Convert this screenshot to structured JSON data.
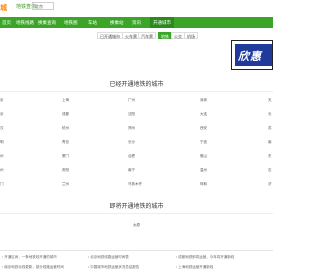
{
  "header": {
    "logo_text": "城",
    "site_name": "地铁查询",
    "city_value": "北京"
  },
  "nav": {
    "items": [
      {
        "label": "首页"
      },
      {
        "label": "地铁线路"
      },
      {
        "label": "换乘查询"
      },
      {
        "label": "地铁图"
      },
      {
        "label": "车站"
      },
      {
        "label": "换乘站"
      },
      {
        "label": "资讯"
      },
      {
        "label": "开通城市"
      }
    ],
    "active_index": 7
  },
  "tabs": {
    "items": [
      {
        "label": "已开通城市"
      },
      {
        "label": "火车票"
      },
      {
        "label": "汽车票"
      },
      {
        "label": "地铁"
      },
      {
        "label": "公交"
      },
      {
        "label": "机场"
      }
    ],
    "active_index": 3
  },
  "ad": {
    "text": "欣惠"
  },
  "sections": {
    "opened_title": "已经开通地铁的城市",
    "upcoming_title": "即将开通地铁的城市"
  },
  "opened_rows": [
    [
      "京",
      "上海",
      "广州",
      "深圳",
      "天"
    ],
    [
      "京",
      "成都",
      "沈阳",
      "大连",
      "长"
    ],
    [
      "汉",
      "杭州",
      "郑州",
      "西安",
      "苏"
    ],
    [
      "明",
      "青岛",
      "长沙",
      "宁波",
      "南"
    ],
    [
      "州",
      "厦门",
      "合肥",
      "佛山",
      "东"
    ],
    [
      "州",
      "贵阳",
      "南宁",
      "温州",
      "石"
    ],
    [
      "门",
      "兰州",
      "乌鲁木齐",
      "呼和",
      "济"
    ]
  ],
  "upcoming_rows": [
    [
      "太原"
    ]
  ],
  "footer": {
    "items": [
      "开通区间，一条地铁线开通的城市",
      "北京地铁线路运营时间表",
      "成都地铁即将运营，今年将开通新线",
      "南京地铁北线更新，部分线路运营时间",
      "中国城市地铁运营状况总结报告",
      "上海地铁运营开通新线"
    ]
  }
}
